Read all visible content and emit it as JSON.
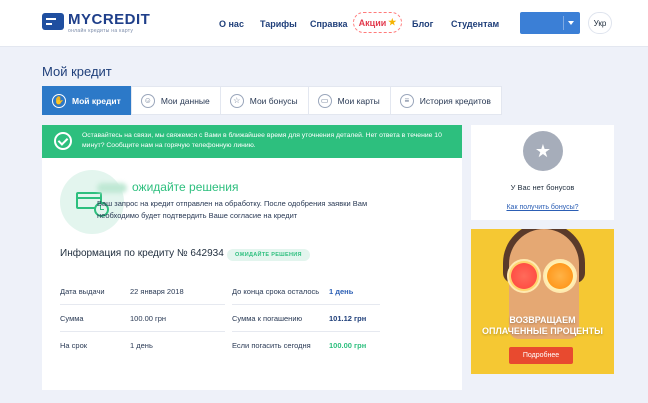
{
  "header": {
    "logo_name": "MYCREDIT",
    "logo_tagline": "онлайн кредиты на карту",
    "nav": [
      {
        "label": "О нас"
      },
      {
        "label": "Тарифы"
      },
      {
        "label": "Справка"
      },
      {
        "label": "Блог"
      },
      {
        "label": "Студентам"
      }
    ],
    "promo_label": "Акции",
    "lang": "Укр"
  },
  "page_title": "Мой кредит",
  "tabs": [
    {
      "label": "Мой кредит",
      "icon": "hand-icon",
      "active": true
    },
    {
      "label": "Мои данные",
      "icon": "user-icon",
      "active": false
    },
    {
      "label": "Мои бонусы",
      "icon": "star-icon",
      "active": false
    },
    {
      "label": "Мои карты",
      "icon": "card-icon",
      "active": false
    },
    {
      "label": "История кредитов",
      "icon": "list-icon",
      "active": false
    }
  ],
  "notice": {
    "text": "Оставайтесь на связи, мы свяжемся с Вами в ближайшее время для уточнения деталей. Нет ответа в течение 10 минут? Сообщите нам на горячую телефонную линию."
  },
  "status": {
    "text": "ожидайте решения",
    "description": "Ваш запрос на кредит отправлен на обработку. После одобрения заявки Вам необходимо будет подтвердить Ваше согласие на кредит"
  },
  "credit_info": {
    "title": "Информация по кредиту № 642934",
    "badge": "ОЖИДАЙТЕ РЕШЕНИЯ",
    "rows": [
      {
        "label1": "Дата выдачи",
        "value1": "22 января 2018",
        "label2": "До конца срока осталось",
        "value2": "1 день"
      },
      {
        "label1": "Сумма",
        "value1": "100.00 грн",
        "label2": "Сумма к погашению",
        "value2": "101.12 грн"
      },
      {
        "label1": "На срок",
        "value1": "1 день",
        "label2": "Если погасить сегодня",
        "value2": "100.00 грн"
      }
    ]
  },
  "bonus": {
    "none_text": "У Вас нет бонусов",
    "link": "Как получить бонусы?"
  },
  "promo_banner": {
    "text_line1": "ВОЗВРАЩАЕМ",
    "text_line2": "ОПЛАЧЕННЫЕ ПРОЦЕНТЫ",
    "button": "Подробнее"
  },
  "colors": {
    "accent": "#2c79c8",
    "success": "#2dbf7e",
    "alert": "#e23b4e"
  }
}
